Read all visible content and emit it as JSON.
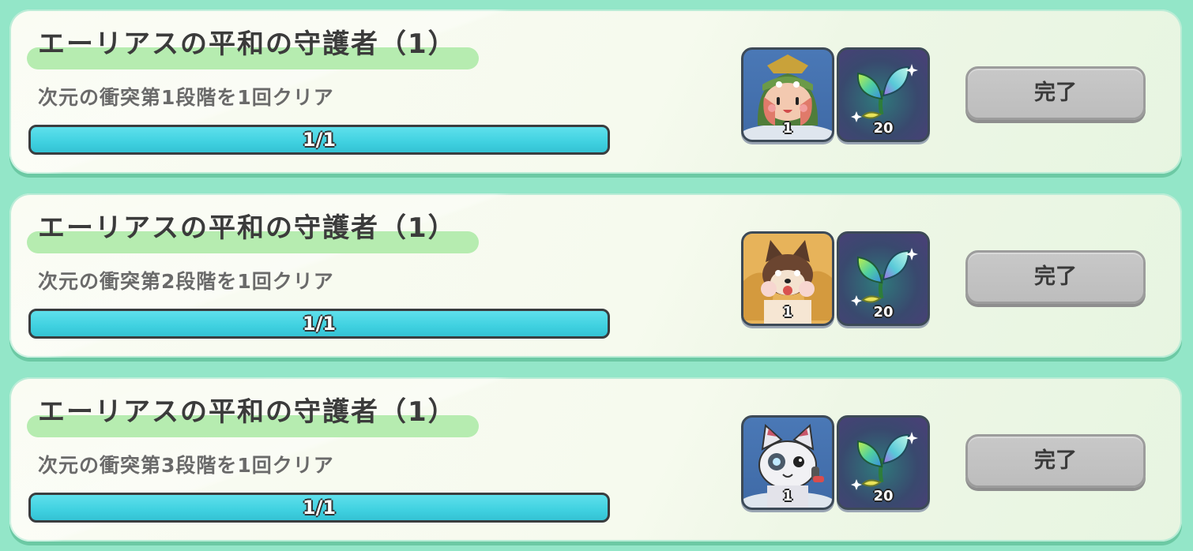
{
  "quests": [
    {
      "title": "エーリアスの平和の守護者（1）",
      "description": "次元の衝突第1段階を1回クリア",
      "progress_text": "1/1",
      "progress_fraction": 1.0,
      "rewards": [
        {
          "icon": "hero-green-hood-icon",
          "count": "1"
        },
        {
          "icon": "rainbow-sprout-icon",
          "count": "20"
        }
      ],
      "button_label": "完了"
    },
    {
      "title": "エーリアスの平和の守護者（1）",
      "description": "次元の衝突第2段階を1回クリア",
      "progress_text": "1/1",
      "progress_fraction": 1.0,
      "rewards": [
        {
          "icon": "hero-fox-icon",
          "count": "1"
        },
        {
          "icon": "rainbow-sprout-icon",
          "count": "20"
        }
      ],
      "button_label": "完了"
    },
    {
      "title": "エーリアスの平和の守護者（1）",
      "description": "次元の衝突第3段階を1回クリア",
      "progress_text": "1/1",
      "progress_fraction": 1.0,
      "rewards": [
        {
          "icon": "hero-robot-cat-icon",
          "count": "1"
        },
        {
          "icon": "rainbow-sprout-icon",
          "count": "20"
        }
      ],
      "button_label": "完了"
    }
  ],
  "colors": {
    "background": "#93e6c8",
    "progress_fill": "#3fd1e0",
    "title_band": "#b6ecb0",
    "done_button": "#c4c4c4"
  }
}
